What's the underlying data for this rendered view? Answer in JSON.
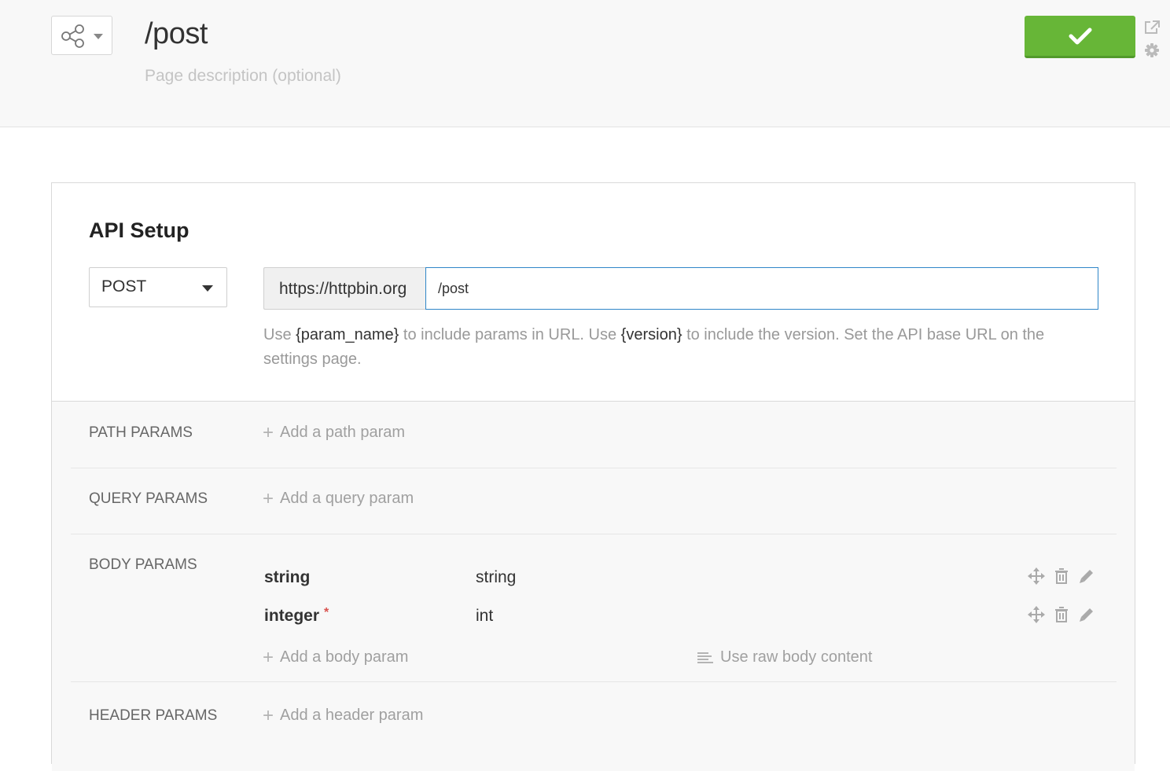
{
  "header": {
    "title": "/post",
    "description_placeholder": "Page description (optional)",
    "save_icon": "check-icon",
    "share_icon": "share-icon",
    "external_icon": "external-link-icon",
    "settings_icon": "gear-icon"
  },
  "api_setup": {
    "title": "API Setup",
    "method": "POST",
    "base_url": "https://httpbin.org",
    "path_value": "/post",
    "hint": {
      "part1": "Use ",
      "param_token": "{param_name}",
      "part2": " to include params in URL. Use ",
      "version_token": "{version}",
      "part3": " to include the version. Set the API base URL on the settings page."
    }
  },
  "params": {
    "path": {
      "label": "PATH PARAMS",
      "add_label": "Add a path param"
    },
    "query": {
      "label": "QUERY PARAMS",
      "add_label": "Add a query param"
    },
    "body": {
      "label": "BODY PARAMS",
      "rows": [
        {
          "name": "string",
          "type": "string",
          "required": false
        },
        {
          "name": "integer",
          "type": "int",
          "required": true,
          "required_mark": "*"
        }
      ],
      "add_label": "Add a body param",
      "raw_label": "Use raw body content"
    },
    "header": {
      "label": "HEADER PARAMS",
      "add_label": "Add a header param"
    }
  },
  "colors": {
    "accent_green": "#67b637",
    "input_focus_border": "#2f86c8",
    "required_red": "#d9534f"
  }
}
